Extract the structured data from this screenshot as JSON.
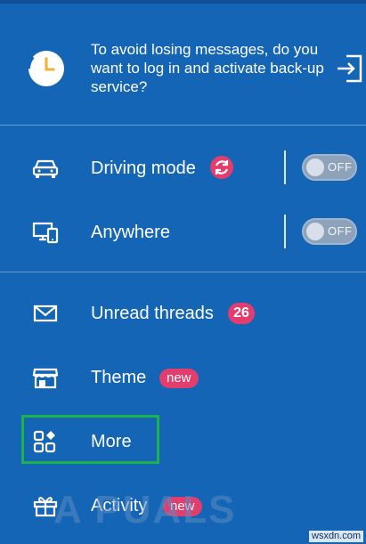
{
  "backup": {
    "message": "To avoid losing messages, do you want to log in and activate back-up service?",
    "icon": "history-clock-icon",
    "action_icon": "login-icon"
  },
  "settings": {
    "driving_mode": {
      "label": "Driving mode",
      "toggle": "OFF",
      "icon": "car-icon"
    },
    "anywhere": {
      "label": "Anywhere",
      "toggle": "OFF",
      "icon": "devices-icon"
    }
  },
  "menu": {
    "unread": {
      "label": "Unread threads",
      "count": "26"
    },
    "theme": {
      "label": "Theme",
      "badge": "new"
    },
    "more": {
      "label": "More"
    },
    "activity": {
      "label": "Activity",
      "badge": "new"
    }
  },
  "watermark": "A PUALS",
  "site": "wsxdn.com",
  "colors": {
    "background": "#1565b7",
    "badge": "#e23d6d",
    "highlight": "#1db34a",
    "toggle_off": "#8ea3ba"
  }
}
